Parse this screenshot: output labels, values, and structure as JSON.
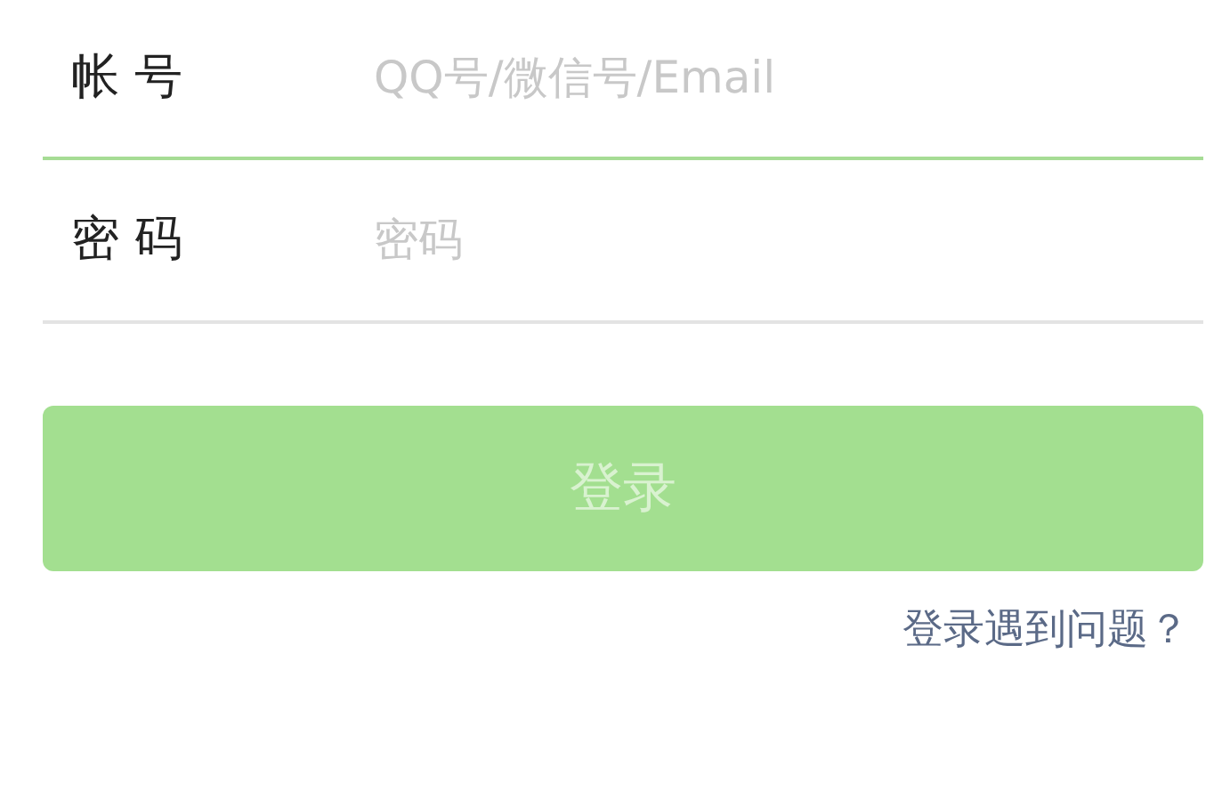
{
  "fields": [
    {
      "label": "帐 号",
      "placeholder": "QQ号/微信号/Email",
      "focused": true
    },
    {
      "label": "密 码",
      "placeholder": "密码",
      "focused": false
    }
  ],
  "login_button": {
    "label": "登录",
    "disabled": true
  },
  "help_link": "登录遇到问题？"
}
